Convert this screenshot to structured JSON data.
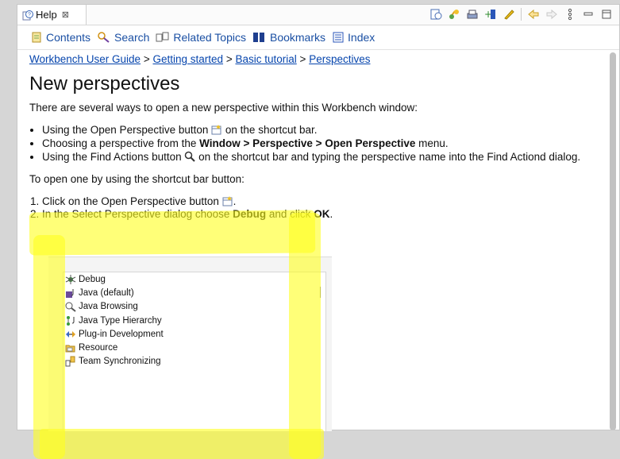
{
  "view": {
    "tab_title": "Help",
    "close_glyph": "⊠"
  },
  "nav": {
    "contents": "Contents",
    "search": "Search",
    "related": "Related Topics",
    "bookmarks": "Bookmarks",
    "index": "Index"
  },
  "breadcrumb": {
    "items": [
      "Workbench User Guide",
      "Getting started",
      "Basic tutorial",
      "Perspectives"
    ],
    "separator": ">"
  },
  "content": {
    "title": "New perspectives",
    "intro": "There are several ways to open a new perspective within this Workbench window:",
    "bullet1_a": "Using the Open Perspective button",
    "bullet1_b": " on the shortcut bar.",
    "bullet2_a": "Choosing a perspective from the ",
    "bullet2_b": "Window > Perspective > Open Perspective",
    "bullet2_c": " menu.",
    "bullet3_a": "Using the Find Actions button",
    "bullet3_b": " on the shortcut bar and typing the perspective name into the Find Actiond dialog.",
    "para2": "To open one by using the shortcut bar button:",
    "step1_a": "Click on the Open Perspective button",
    "step1_b": ".",
    "step2_a": "In the Select Perspective dialog choose ",
    "step2_b": "Debug",
    "step2_c": " and click ",
    "step2_d": "OK",
    "step2_e": "."
  },
  "dialog": {
    "items": [
      "Debug",
      "Java (default)",
      "Java Browsing",
      "Java Type Hierarchy",
      "Plug-in Development",
      "Resource",
      "Team Synchronizing"
    ]
  },
  "colors": {
    "link": "#0645ad",
    "highlight": "#ffff1e"
  }
}
